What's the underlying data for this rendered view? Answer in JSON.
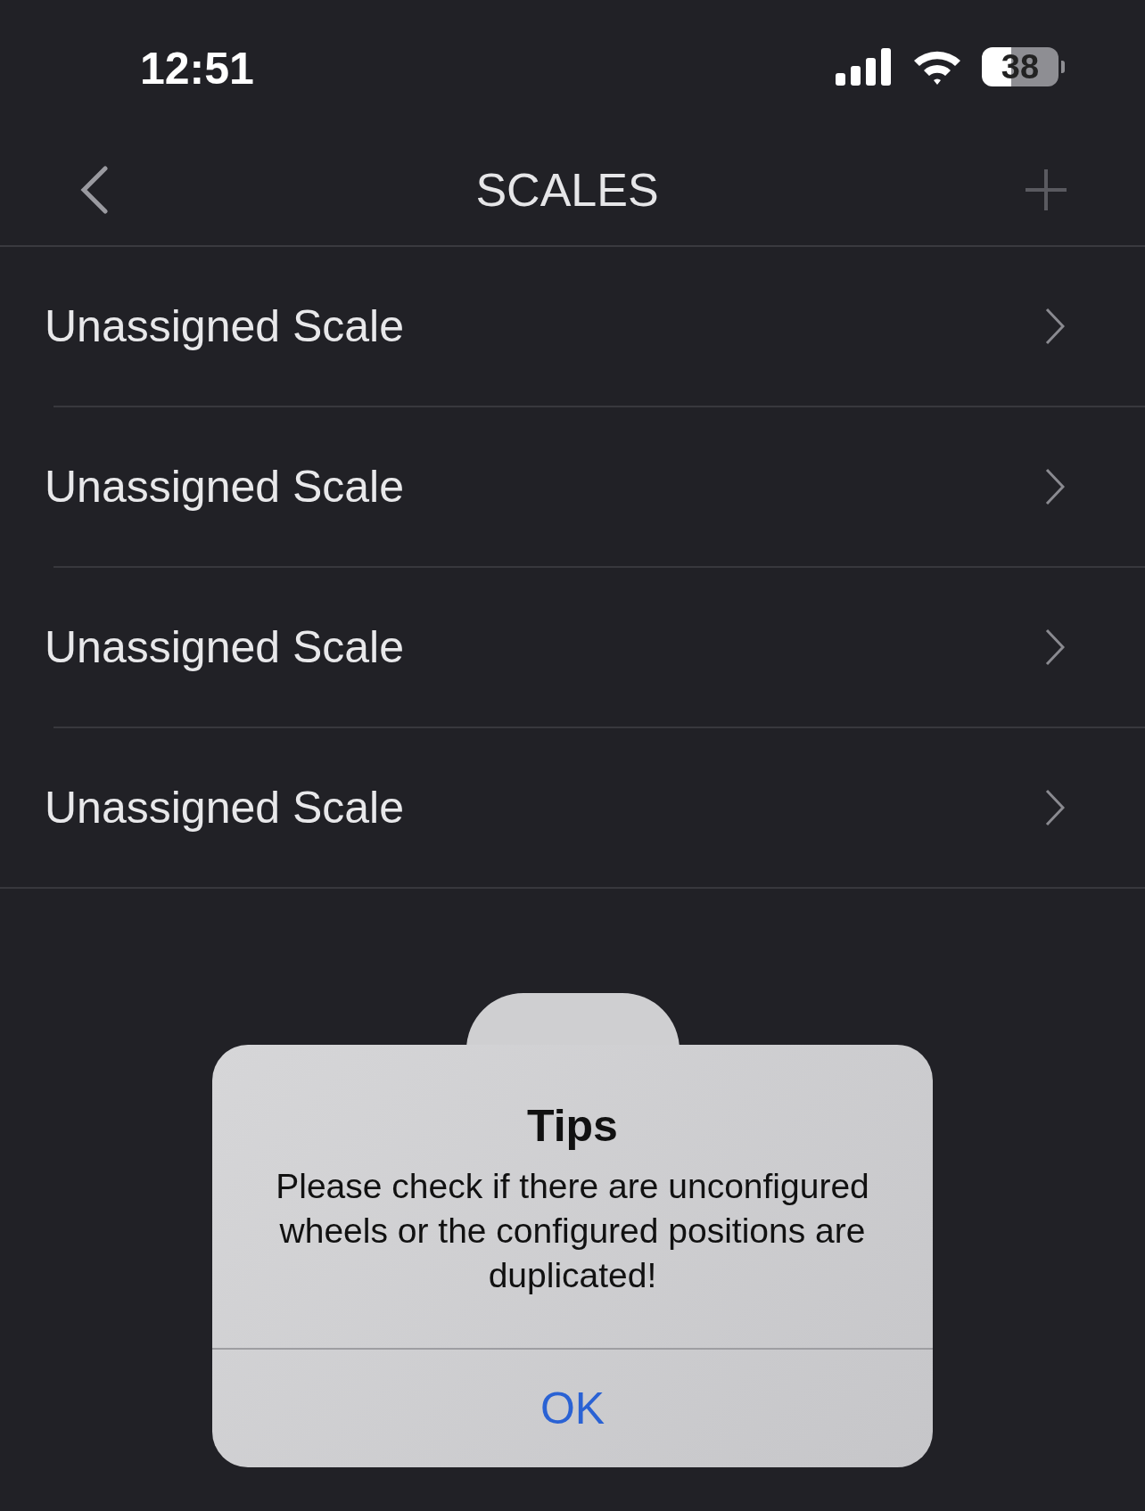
{
  "status_bar": {
    "time": "12:51",
    "battery": "38"
  },
  "nav": {
    "title": "SCALES"
  },
  "rows": [
    {
      "label": "Unassigned Scale"
    },
    {
      "label": "Unassigned Scale"
    },
    {
      "label": "Unassigned Scale"
    },
    {
      "label": "Unassigned Scale"
    }
  ],
  "dialog": {
    "title": "Tips",
    "message": "Please check if there are unconfigured wheels or the configured positions are duplicated!",
    "button": "OK"
  }
}
